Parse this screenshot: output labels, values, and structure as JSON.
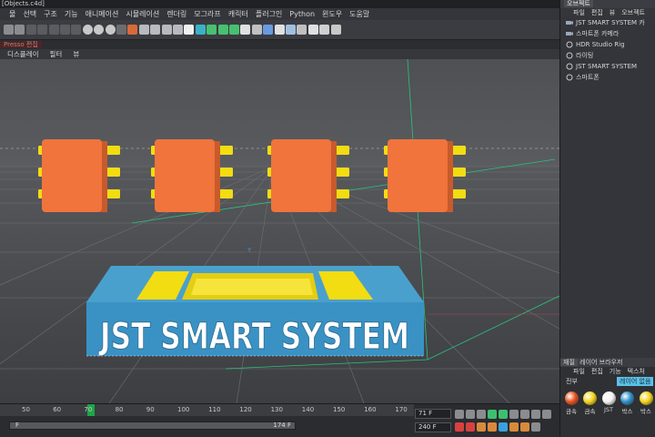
{
  "window": {
    "title": "[Objects.c4d]"
  },
  "menubar": [
    "물",
    "선택",
    "구조",
    "기능",
    "애니메이션",
    "시뮬레이션",
    "렌더링",
    "모그라프",
    "캐릭터",
    "플러그인",
    "Python",
    "윈도우",
    "도움말"
  ],
  "toolbar": {
    "icons": [
      "undo-icon",
      "redo-icon",
      "select-icon",
      "move-icon",
      "scale-icon",
      "rotate-icon",
      "recent-tool-icon",
      "x-axis-icon",
      "y-axis-icon",
      "z-axis-icon",
      "world-coords-icon",
      "render-region-icon",
      "render-view-icon",
      "render-queue-icon",
      "render-settings-icon",
      "render-active-icon",
      "cube-icon",
      "spline-icon",
      "nurbs-icon",
      "array-icon",
      "deformer-icon",
      "scene-icon",
      "camera-icon",
      "light-icon",
      "tag-icon",
      "texture-icon",
      "mograph-icon",
      "cloner-icon",
      "effector-icon",
      "python-icon"
    ]
  },
  "xpresso_label": "Presso 편집",
  "viewport_menu": [
    "디스플레이",
    "필터",
    "뷰"
  ],
  "viewport": {
    "chips": 4,
    "pins_per_side": 3,
    "logo_text": "JST SMART SYSTEM",
    "colors": {
      "chip": "#f0743c",
      "pin": "#f2dc12",
      "base": "#3a92c4",
      "base_top": "#4aa0cd",
      "floor": "#4a4c50",
      "grid": "#66686c"
    }
  },
  "timeline": {
    "ticks": [
      "50",
      "60",
      "70",
      "80",
      "90",
      "100",
      "110",
      "120",
      "130",
      "140",
      "150",
      "160",
      "170"
    ],
    "current_frame": "71 F",
    "end_frame": "240 F",
    "scrub_start": "F",
    "scrub_end": "174 F"
  },
  "object_manager": {
    "title": "오브젝트",
    "menu": [
      "파일",
      "편집",
      "뷰",
      "오브젝트"
    ],
    "items": [
      {
        "label": "JST SMART SYSTEM 카",
        "icon": "camera-icon"
      },
      {
        "label": "스마트폰 카메라",
        "icon": "camera-icon"
      },
      {
        "label": "HDR Studio Rig",
        "icon": "null-icon"
      },
      {
        "label": "라이팅",
        "icon": "null-icon"
      },
      {
        "label": "JST SMART SYSTEM",
        "icon": "null-icon"
      },
      {
        "label": "스마트폰",
        "icon": "null-icon"
      }
    ]
  },
  "material_manager": {
    "tabs": [
      "재질",
      "레이어 브라우저"
    ],
    "menu": [
      "파일",
      "편집",
      "기능",
      "텍스처"
    ],
    "subtabs": [
      "전부",
      "레이어 없음"
    ],
    "materials": [
      {
        "label": "금속",
        "color": "#e8521e"
      },
      {
        "label": "금속",
        "color": "#f4d41a"
      },
      {
        "label": "JST",
        "color": "#f1f1f1"
      },
      {
        "label": "박스",
        "color": "#2e8fc8"
      },
      {
        "label": "박스",
        "color": "#f4d41a"
      }
    ]
  }
}
